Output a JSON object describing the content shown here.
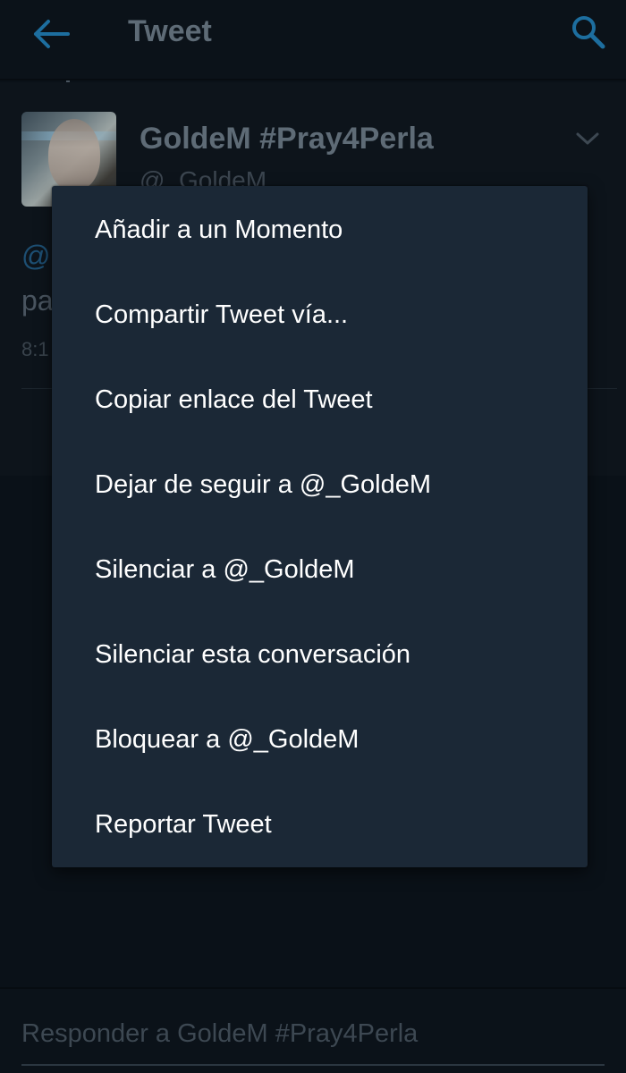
{
  "header": {
    "title": "Tweet",
    "back_icon": "arrow-left",
    "search_icon": "search",
    "accent_color": "#1d9bf0"
  },
  "tweet": {
    "display_name": "GoldeM #Pray4Perla",
    "username": "@_GoldeM",
    "mention_fragment": "@",
    "text_fragment": "pa",
    "time_fragment": "8:1",
    "menu_icon": "chevron-down"
  },
  "menu": {
    "items": [
      {
        "label": "Añadir a un Momento"
      },
      {
        "label": "Compartir Tweet vía..."
      },
      {
        "label": "Copiar enlace del Tweet"
      },
      {
        "label": "Dejar de seguir a @_GoldeM"
      },
      {
        "label": "Silenciar a @_GoldeM"
      },
      {
        "label": "Silenciar esta conversación"
      },
      {
        "label": "Bloquear a @_GoldeM"
      },
      {
        "label": "Reportar Tweet"
      }
    ]
  },
  "reply": {
    "placeholder": "Responder a GoldeM #Pray4Perla"
  }
}
